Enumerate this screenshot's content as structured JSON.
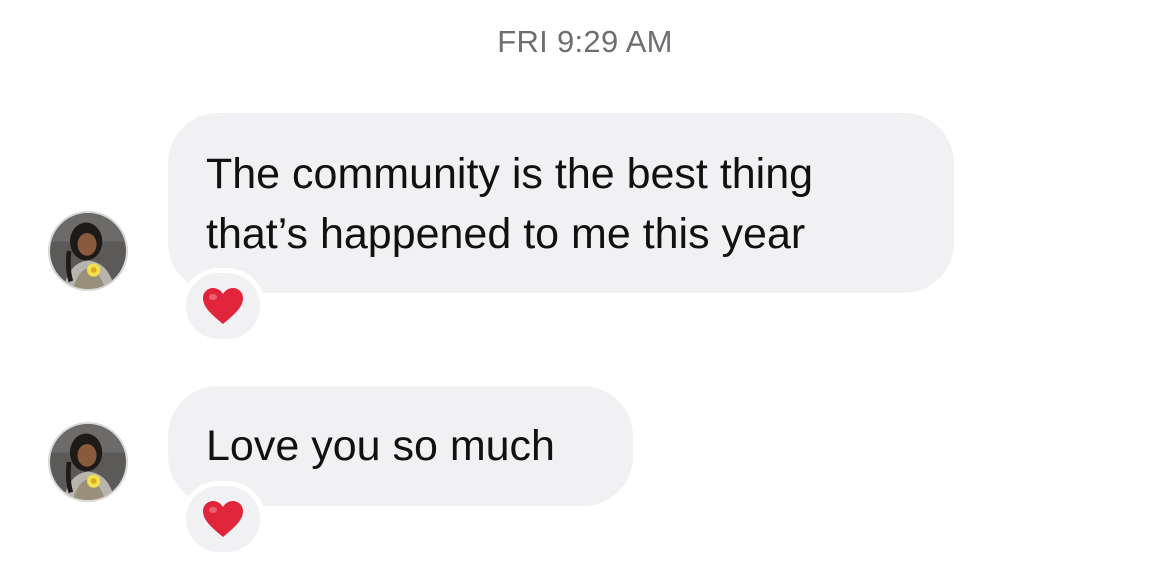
{
  "thread": {
    "timestamp": "FRI 9:29 AM",
    "messages": [
      {
        "lines": [
          "The community is the best thing",
          "that’s happened to me this year"
        ],
        "reaction": "red-heart-icon"
      },
      {
        "lines": [
          "Love you so much"
        ],
        "reaction": "red-heart-icon"
      }
    ]
  },
  "colors": {
    "bubble_bg": "#f1f1f3",
    "timestamp": "#6e6e73",
    "heart": "#e0243a"
  }
}
